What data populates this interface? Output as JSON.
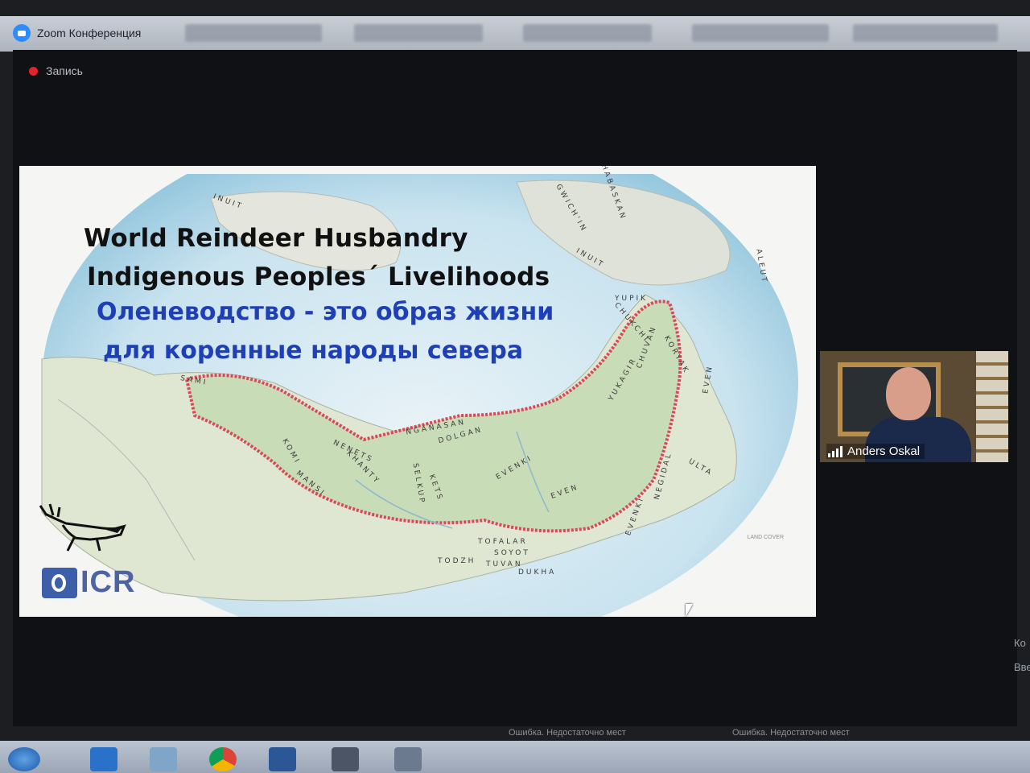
{
  "app": {
    "tab_title": "Zoom Конференция",
    "recording_label": "Запись"
  },
  "slide": {
    "title_line1": "World Reindeer Husbandry",
    "title_line2": "Indigenous Peoples´ Livelihoods",
    "subtitle_ru_line1": "Оленеводство - это образ жизни",
    "subtitle_ru_line2": "для коренные народы севера",
    "logo_text": "ICR",
    "map_labels": [
      "INUIT",
      "ATHABASKAN",
      "GWICH'IN",
      "INUIT",
      "YUPIK",
      "CHUKCHI",
      "CHUVAN",
      "KORYAK",
      "EVEN",
      "YUKAGIR",
      "NGANASAN",
      "DOLGAN",
      "NENETS",
      "KOMI",
      "EVENKI",
      "EVEN",
      "SELKUP",
      "KHANTY",
      "MANSI",
      "KETS",
      "NEGIDAL",
      "EVENKI",
      "ULTA",
      "TOFALAR",
      "SOYOT",
      "TUVAN",
      "TODZH",
      "DUKHA",
      "ALEUT",
      "SAMI"
    ],
    "legend_label": "LAND COVER"
  },
  "participant": {
    "name": "Anders Oskal"
  },
  "side_text": [
    "Ко",
    "Вве"
  ],
  "status_messages": [
    "Ошибка. Недостаточно мест",
    "Ошибка. Недостаточно мест"
  ],
  "colors": {
    "recording": "#e0242a",
    "title_ru": "#1e3fb5",
    "title_en": "#111111",
    "territory_outline": "#d8485a",
    "zoom_blue": "#2d8cff"
  }
}
